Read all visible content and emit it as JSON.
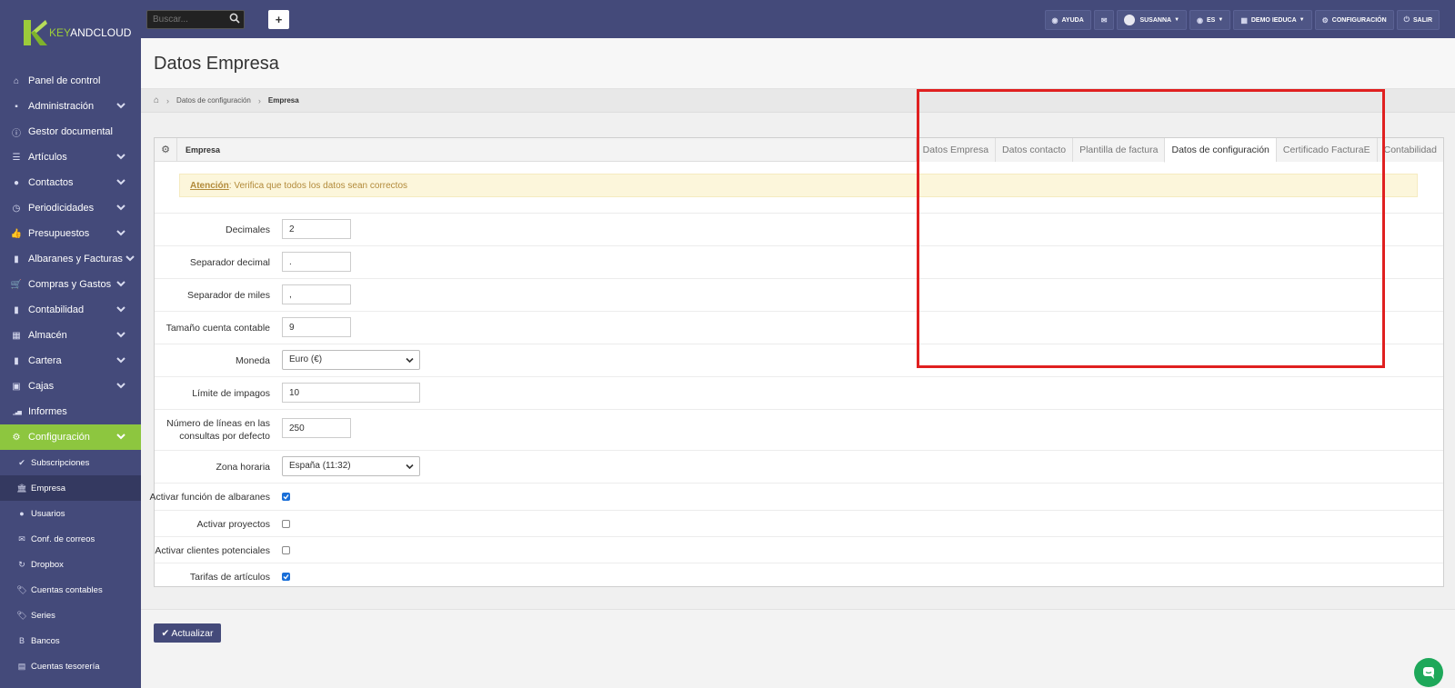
{
  "brand": {
    "logo_letter": "K",
    "name_pre": "KEY",
    "name_post": "ANDCLOUD",
    "accent": "#8dc63f",
    "primary": "#444a7a"
  },
  "sidebar": {
    "items": [
      {
        "label": "Panel de control",
        "icon": "home-icon",
        "glyph": "⌂",
        "has_chevron": false
      },
      {
        "label": "Administración",
        "icon": "briefcase-icon",
        "glyph": "▪",
        "has_chevron": true
      },
      {
        "label": "Gestor documental",
        "icon": "info-icon",
        "glyph": "ⓘ",
        "has_chevron": false
      },
      {
        "label": "Artículos",
        "icon": "list-icon",
        "glyph": "☰",
        "has_chevron": true
      },
      {
        "label": "Contactos",
        "icon": "user-icon",
        "glyph": "●",
        "has_chevron": true
      },
      {
        "label": "Periodicidades",
        "icon": "clock-icon",
        "glyph": "◷",
        "has_chevron": true
      },
      {
        "label": "Presupuestos",
        "icon": "thumbs-up-icon",
        "glyph": "👍",
        "has_chevron": true
      },
      {
        "label": "Albaranes y Facturas",
        "icon": "file-icon",
        "glyph": "▮",
        "has_chevron": true
      },
      {
        "label": "Compras y Gastos",
        "icon": "cart-icon",
        "glyph": "🛒",
        "has_chevron": true
      },
      {
        "label": "Contabilidad",
        "icon": "document-icon",
        "glyph": "▮",
        "has_chevron": true
      },
      {
        "label": "Almacén",
        "icon": "grid-icon",
        "glyph": "▦",
        "has_chevron": true
      },
      {
        "label": "Cartera",
        "icon": "book-icon",
        "glyph": "▮",
        "has_chevron": true
      },
      {
        "label": "Cajas",
        "icon": "inbox-icon",
        "glyph": "▣",
        "has_chevron": true
      },
      {
        "label": "Informes",
        "icon": "bar-chart-icon",
        "glyph": "▁▃▅",
        "has_chevron": false
      },
      {
        "label": "Configuración",
        "icon": "gear-icon",
        "glyph": "⚙",
        "has_chevron": true,
        "active": true
      }
    ],
    "subitems": [
      {
        "label": "Subscripciones",
        "icon": "check-circle-icon",
        "glyph": "✔"
      },
      {
        "label": "Empresa",
        "icon": "bank-icon",
        "glyph": "🏛",
        "current": true
      },
      {
        "label": "Usuarios",
        "icon": "user-icon",
        "glyph": "●"
      },
      {
        "label": "Conf. de correos",
        "icon": "envelope-icon",
        "glyph": "✉"
      },
      {
        "label": "Dropbox",
        "icon": "refresh-icon",
        "glyph": "↻"
      },
      {
        "label": "Cuentas contables",
        "icon": "tags-icon",
        "glyph": "🏷"
      },
      {
        "label": "Series",
        "icon": "tags-icon",
        "glyph": "🏷"
      },
      {
        "label": "Bancos",
        "icon": "bitcoin-icon",
        "glyph": "B"
      },
      {
        "label": "Cuentas tesorería",
        "icon": "table-icon",
        "glyph": "▤"
      }
    ]
  },
  "topbar": {
    "search_placeholder": "Buscar...",
    "plus_label": "+",
    "buttons": [
      {
        "label": "AYUDA",
        "icon": "help-icon",
        "glyph": "◉",
        "caret": false
      },
      {
        "label": "",
        "icon": "envelope-icon",
        "glyph": "✉",
        "caret": false
      },
      {
        "label": "SUSANNA",
        "icon": "avatar",
        "glyph": "",
        "caret": true
      },
      {
        "label": "ES",
        "icon": "globe-icon",
        "glyph": "◉",
        "caret": true
      },
      {
        "label": "DEMO IEDUCA",
        "icon": "building-icon",
        "glyph": "▦",
        "caret": true
      },
      {
        "label": "CONFIGURACIÓN",
        "icon": "gear-icon",
        "glyph": "⚙",
        "caret": false
      },
      {
        "label": "SALIR",
        "icon": "power-icon",
        "glyph": "⏻",
        "caret": false
      }
    ]
  },
  "page": {
    "title": "Datos Empresa",
    "breadcrumb": {
      "level1": "Datos de configuración",
      "current": "Empresa"
    }
  },
  "panel": {
    "title": "Empresa",
    "tabs": [
      {
        "label": "Datos Empresa",
        "active": false
      },
      {
        "label": "Datos contacto",
        "active": false
      },
      {
        "label": "Plantilla de factura",
        "active": false
      },
      {
        "label": "Datos de configuración",
        "active": true
      },
      {
        "label": "Certificado FacturaE",
        "active": false
      },
      {
        "label": "Contabilidad",
        "active": false
      }
    ],
    "alert": {
      "strong": "Atención",
      "text": ": Verifica que todos los datos sean correctos"
    }
  },
  "form": {
    "fields": [
      {
        "label": "Decimales",
        "type": "text",
        "value": "2",
        "width": "short"
      },
      {
        "label": "Separador decimal",
        "type": "text",
        "value": ".",
        "width": "short"
      },
      {
        "label": "Separador de miles",
        "type": "text",
        "value": ",",
        "width": "short"
      },
      {
        "label": "Tamaño cuenta contable",
        "type": "text",
        "value": "9",
        "width": "short"
      },
      {
        "label": "Moneda",
        "type": "select",
        "value": "Euro (€)"
      },
      {
        "label": "Límite de impagos",
        "type": "text",
        "value": "10",
        "width": "long"
      },
      {
        "label_line1": "Número de líneas en las",
        "label_line2": "consultas por defecto",
        "type": "text",
        "value": "250",
        "width": "short"
      },
      {
        "label": "Zona horaria",
        "type": "select",
        "value": "España (11:32)"
      },
      {
        "label": "Activar función de albaranes",
        "type": "checkbox",
        "checked": true
      },
      {
        "label": "Activar proyectos",
        "type": "checkbox",
        "checked": false
      },
      {
        "label": "Activar clientes potenciales",
        "type": "checkbox",
        "checked": false
      },
      {
        "label": "Tarifas de artículos",
        "type": "checkbox",
        "checked": true
      }
    ]
  },
  "actions": {
    "update_label": "Actualizar",
    "update_icon": "check-icon"
  },
  "chat": {
    "icon": "chat-icon"
  }
}
